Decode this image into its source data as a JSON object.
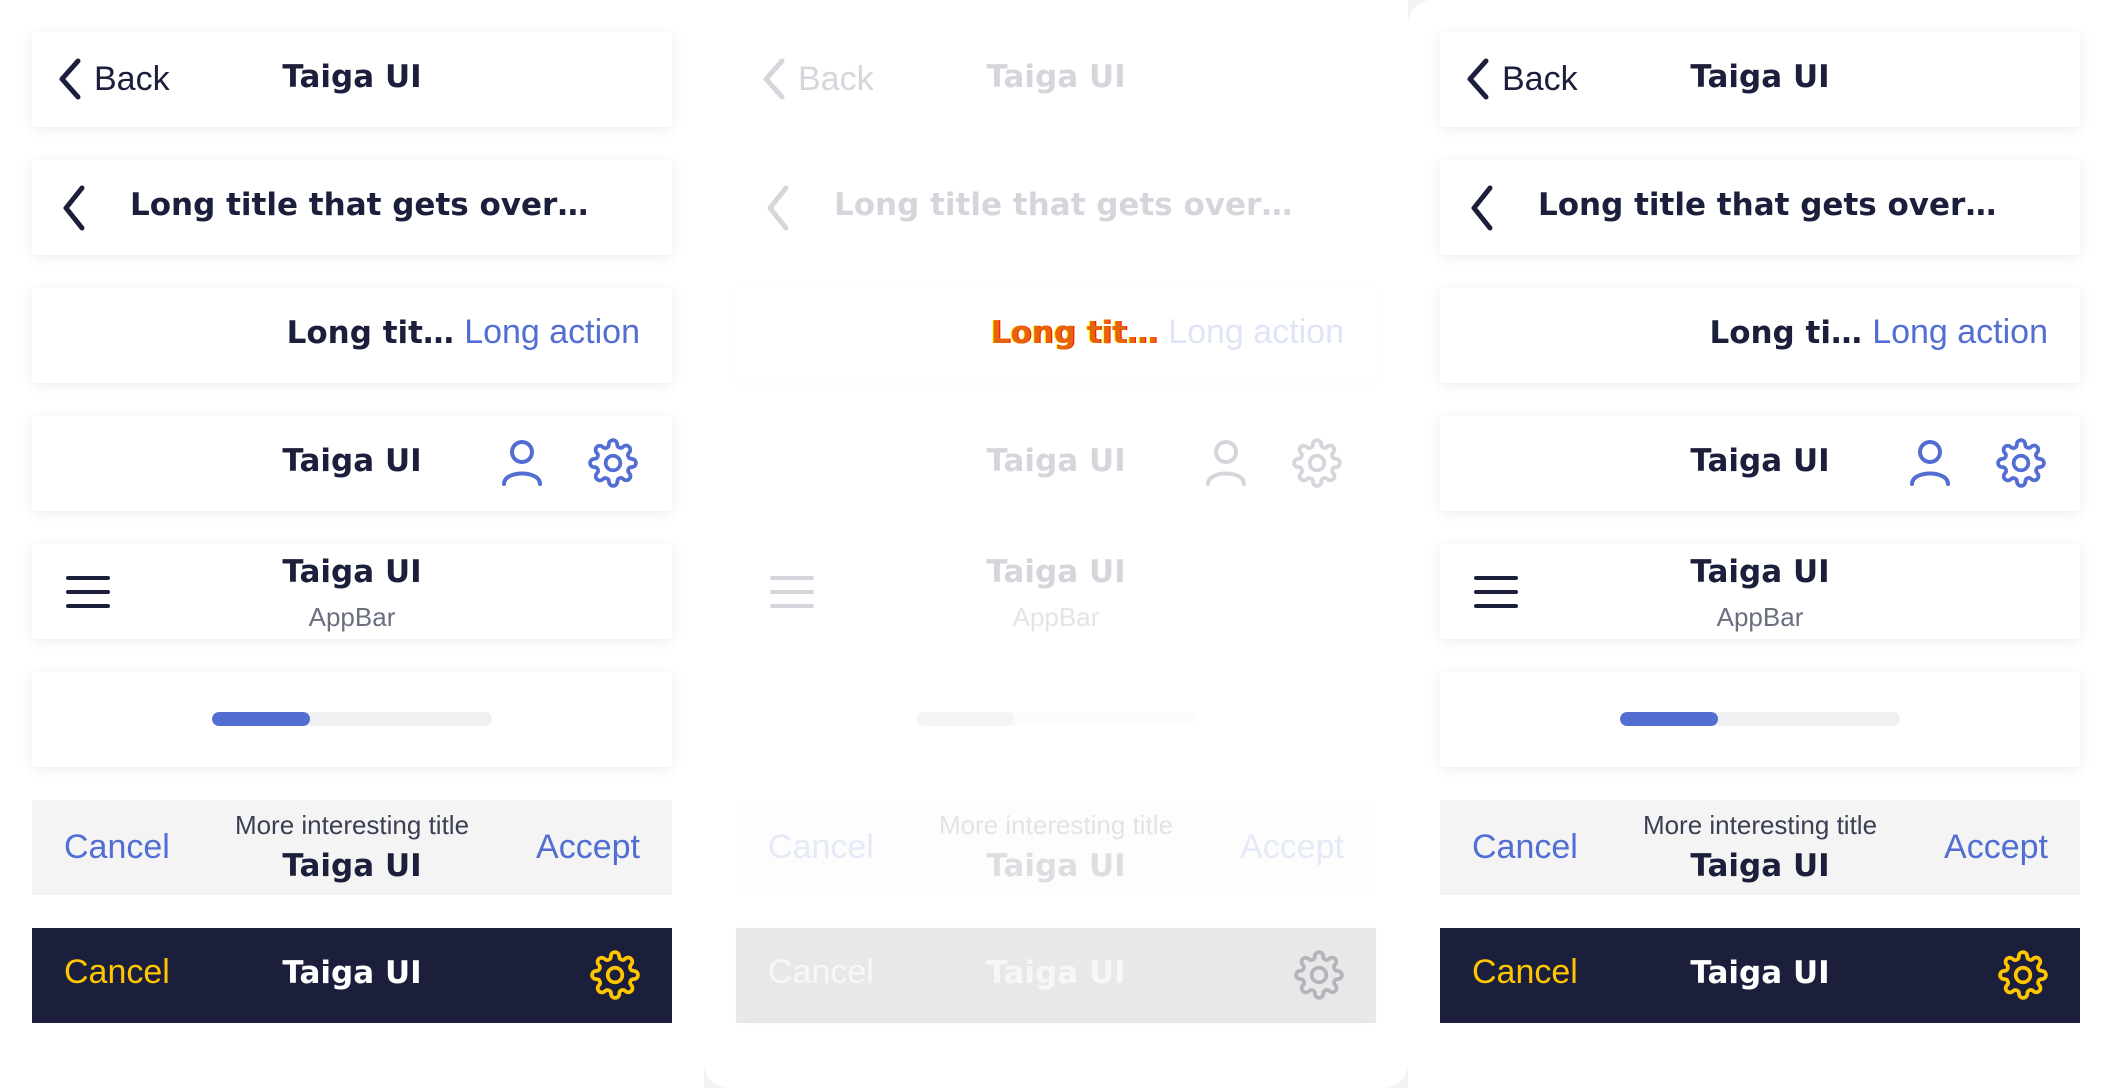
{
  "colors": {
    "primary": "#1b1f3b",
    "link": "#526ed3",
    "accent_yellow": "#ffc600",
    "dark_bar": "#1b1f3b",
    "secondary_bar": "#f4f4f5"
  },
  "back_label": "Back",
  "app_title": "Taiga UI",
  "long_title": "Long title that gets overflo…",
  "long_title_short": "Long ti…",
  "long_title_short_2": "Long tit…",
  "long_action": "Long action",
  "appbar_subtitle": "AppBar",
  "more_title": "More interesting title",
  "cancel_label": "Cancel",
  "accept_label": "Accept",
  "progress": {
    "value": 0.35
  },
  "icons": {
    "back": "chevron-left-icon",
    "user": "user-icon",
    "settings": "gear-icon",
    "menu": "menu-icon"
  }
}
